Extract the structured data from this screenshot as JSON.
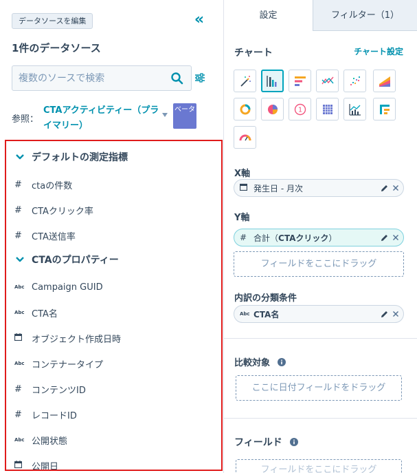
{
  "left": {
    "edit_button": "データソースを編集",
    "collapse_glyph": "«",
    "title": "1件のデータソース",
    "search_placeholder": "複数のソースで検索",
    "ref_label": "参照：",
    "ref_value": "CTAアクティビティー（プライマリー）",
    "beta_label": "ベータ",
    "groups": [
      {
        "title": "デフォルトの測定指標",
        "items": [
          {
            "icon": "#",
            "label": "ctaの件数"
          },
          {
            "icon": "#",
            "label": "CTAクリック率"
          },
          {
            "icon": "#",
            "label": "CTA送信率"
          }
        ]
      },
      {
        "title": "CTAのプロパティー",
        "items": [
          {
            "icon": "Abc",
            "label": "Campaign GUID"
          },
          {
            "icon": "Abc",
            "label": "CTA名"
          },
          {
            "icon": "cal",
            "label": "オブジェクト作成日時"
          },
          {
            "icon": "Abc",
            "label": "コンテナータイプ"
          },
          {
            "icon": "#",
            "label": "コンテンツID"
          },
          {
            "icon": "#",
            "label": "レコードID"
          },
          {
            "icon": "Abc",
            "label": "公開状態"
          },
          {
            "icon": "cal",
            "label": "公開日"
          }
        ]
      }
    ]
  },
  "right": {
    "tabs": [
      "設定",
      "フィルター（1）"
    ],
    "chart_heading": "チャート",
    "chart_settings": "チャート設定",
    "chart_types": [
      "magic-wand",
      "vertical-bar",
      "horizontal-bar",
      "line",
      "scatter",
      "area",
      "donut",
      "pie",
      "kpi",
      "table",
      "combo",
      "pivot",
      "gauge"
    ],
    "x_axis_label": "X軸",
    "x_axis_pill": "発生日 - 月次",
    "y_axis_label": "Y軸",
    "y_axis_pill_prefix": "合計（",
    "y_axis_pill_bold": "CTAクリック",
    "y_axis_pill_suffix": "）",
    "drop_field": "フィールドをここにドラッグ",
    "breakdown_label": "内訳の分類条件",
    "breakdown_pill": "CTA名",
    "compare_label": "比較対象",
    "compare_drop": "ここに日付フィールドをドラッグ",
    "fields_label": "フィールド",
    "fields_drop": "フィールドをここにドラッグ",
    "colors": {
      "accent": "#0091ae",
      "highlight": "#e01b1b",
      "beta": "#6a78d1"
    }
  }
}
